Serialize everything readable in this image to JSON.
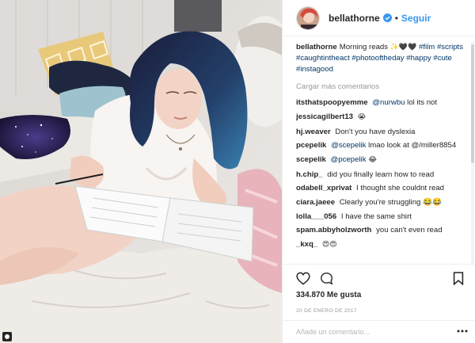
{
  "post": {
    "username": "bellathorne",
    "follow_label": "Seguir",
    "separator": "•",
    "caption_username": "bellathorne",
    "caption_text": "Morning reads ",
    "caption_emoji": "✨🖤🖤",
    "hashtags": [
      "#film",
      "#scripts",
      "#caughtintheact",
      "#photooftheday",
      "#happy",
      "#cute",
      "#instagood"
    ],
    "load_more_label": "Cargar más comentarios",
    "likes": "334.870 Me gusta",
    "date": "20 DE ENERO DE 2017",
    "comment_placeholder": "Añade un comentario..."
  },
  "comments": [
    {
      "user": "itsthatspoopyemme",
      "mention": "@nurwbu",
      "text": " lol its not"
    },
    {
      "user": "jessicagilbert13",
      "mention": "",
      "text": "😭"
    },
    {
      "user": "hj.weaver",
      "mention": "",
      "text": "Don't you have dyslexia"
    },
    {
      "user": "pcepelik",
      "mention": "@scepelik",
      "text": " lmao look at @/miller8854"
    },
    {
      "user": "scepelik",
      "mention": "@pcepelik",
      "text": " 😂"
    },
    {
      "user": "h.chip_",
      "mention": "",
      "text": "did you finally learn how to read"
    },
    {
      "user": "odabell_xprivat",
      "mention": "",
      "text": "I thought she couldnt read"
    },
    {
      "user": "ciara.jaeee",
      "mention": "",
      "text": "Clearly you're struggling 😂😂"
    },
    {
      "user": "lolla___056",
      "mention": "",
      "text": "I have the same shirt"
    },
    {
      "user": "spam.abbyholzworth",
      "mention": "",
      "text": "you can't even read"
    },
    {
      "user": "_kxq_",
      "mention": "",
      "text": "😍😍"
    }
  ],
  "icons": {
    "verified": "verified-badge-icon",
    "like": "heart-icon",
    "comment": "comment-bubble-icon",
    "save": "bookmark-icon",
    "more": "more-options-icon"
  },
  "colors": {
    "link": "#003569",
    "follow": "#3897f0",
    "verified": "#3897f0",
    "hair": "#1c2a4f"
  }
}
